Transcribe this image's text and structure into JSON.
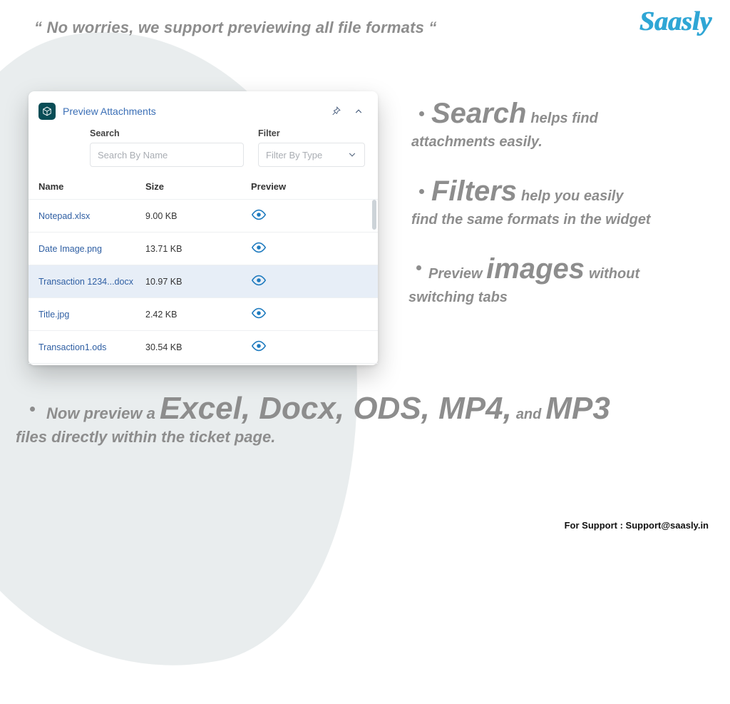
{
  "brand": "Saasly",
  "tagline": "“ No worries, we support previewing all file formats “",
  "widget": {
    "title": "Preview Attachments",
    "search": {
      "label": "Search",
      "placeholder": "Search By Name"
    },
    "filter": {
      "label": "Filter",
      "placeholder": "Filter By Type"
    },
    "columns": {
      "name": "Name",
      "size": "Size",
      "preview": "Preview"
    },
    "rows": [
      {
        "name": "Notepad.xlsx",
        "size": "9.00 KB",
        "selected": false
      },
      {
        "name": "Date Image.png",
        "size": "13.71 KB",
        "selected": false
      },
      {
        "name": "Transaction 1234...docx",
        "size": "10.97 KB",
        "selected": true
      },
      {
        "name": "Title.jpg",
        "size": "2.42 KB",
        "selected": false
      },
      {
        "name": "Transaction1.ods",
        "size": "30.54 KB",
        "selected": false
      }
    ]
  },
  "bullets": {
    "b1": {
      "big": "Search",
      "after": "helps find",
      "line2": "attachments easily."
    },
    "b2": {
      "big": "Filters",
      "after": "help you easily",
      "line2": "find the same formats in the widget"
    },
    "b3": {
      "pre": "Preview",
      "big": "images",
      "after": "without",
      "line2": "switching tabs"
    }
  },
  "bottom": {
    "lead": "Now preview a",
    "formats": "Excel, Docx, ODS, MP4,",
    "and": "and",
    "last": "MP3",
    "line2": "files directly within the ticket page."
  },
  "support": {
    "label": "For Support : ",
    "email": "Support@saasly.in"
  }
}
